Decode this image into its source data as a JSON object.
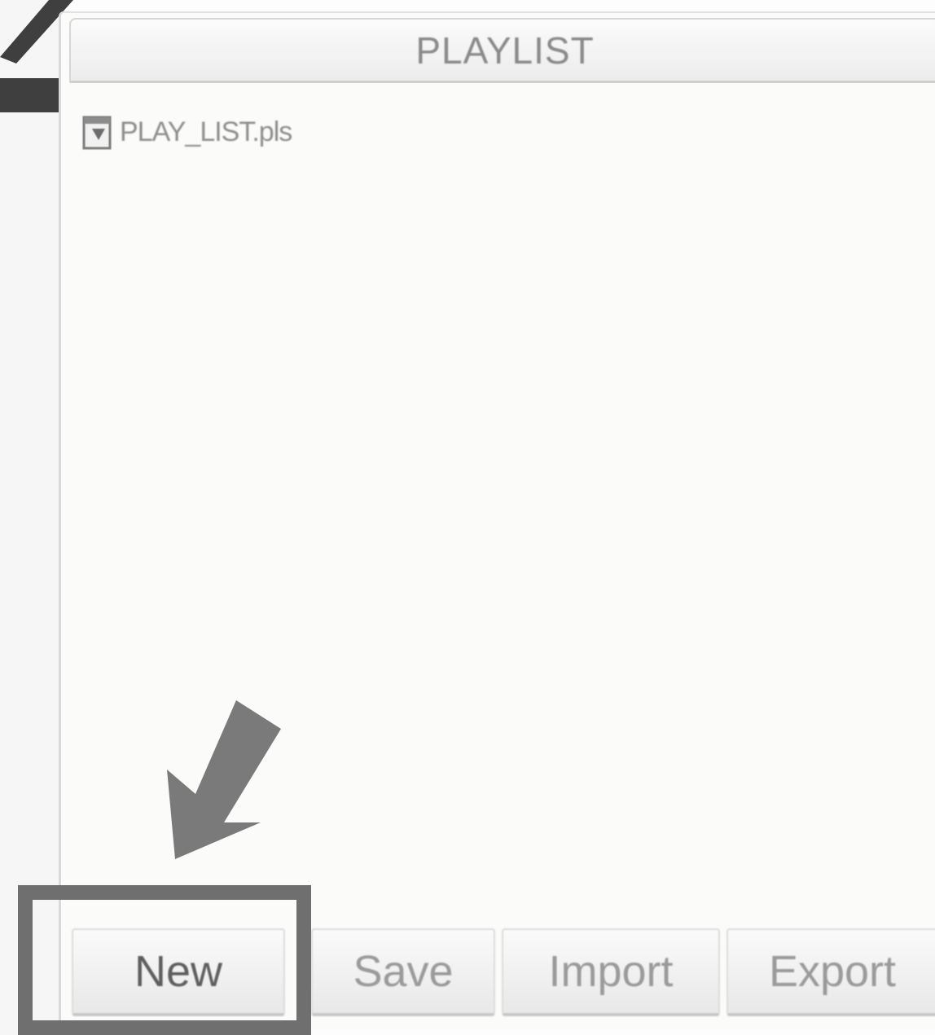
{
  "playlist": {
    "title": "PLAYLIST",
    "items": [
      {
        "name": "PLAY_LIST.pls",
        "icon": "playlist-file-icon"
      }
    ]
  },
  "buttons": {
    "new_label": "New",
    "save_label": "Save",
    "import_label": "Import",
    "export_label": "Export"
  },
  "annotations": {
    "highlight_color": "#6f6f6f",
    "arrow_color": "#7a7a7a",
    "arrow_icon": "arrow-down-left-icon"
  }
}
